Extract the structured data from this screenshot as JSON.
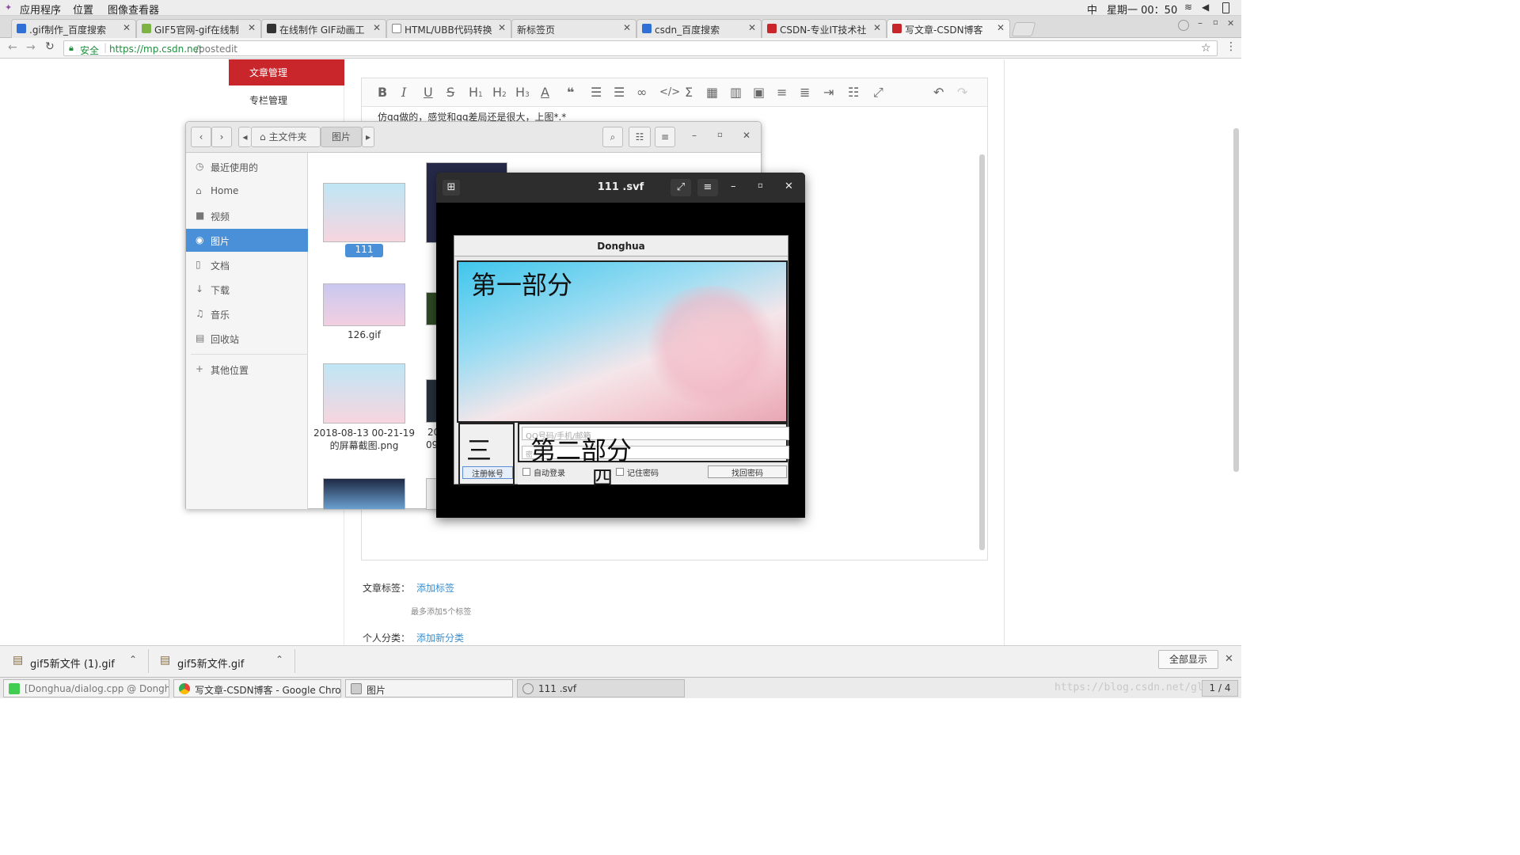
{
  "topbar": {
    "apps": "应用程序",
    "places": "位置",
    "viewer_app": "图像查看器",
    "ime": "中",
    "clock": "星期一 00：50"
  },
  "tabs": [
    {
      "label": ".gif制作_百度搜索",
      "color": "#2f6fd6"
    },
    {
      "label": "GIF5官网-gif在线制",
      "color": "#7cb342"
    },
    {
      "label": "在线制作 GIF动画工",
      "color": "#333333"
    },
    {
      "label": "HTML/UBB代码转换",
      "color": "#888888"
    },
    {
      "label": "新标签页",
      "color": "#cccccc"
    },
    {
      "label": "csdn_百度搜索",
      "color": "#2f6fd6"
    },
    {
      "label": "CSDN-专业IT技术社",
      "color": "#c9262c"
    },
    {
      "label": "写文章-CSDN博客",
      "color": "#c9262c"
    }
  ],
  "address": {
    "secure": "安全",
    "url_host": "https://mp.csdn.net",
    "url_path": "/postedit"
  },
  "leftnav": {
    "article_mgmt": "文章管理",
    "column_mgmt": "专栏管理"
  },
  "editor": {
    "content": "仿qq做的，感觉和qq差局还是很大，上图*.*"
  },
  "post_meta": {
    "tags_label": "文章标签：",
    "add_tag": "添加标签",
    "tag_hint": "最多添加5个标签",
    "category_label": "个人分类：",
    "add_category": "添加新分类"
  },
  "files": {
    "path_home": "主文件夹",
    "path_pictures": "图片",
    "sidebar": [
      {
        "label": "最近使用的",
        "icon": "clock-icon"
      },
      {
        "label": "Home",
        "icon": "home-icon"
      },
      {
        "label": "视频",
        "icon": "video-icon"
      },
      {
        "label": "图片",
        "icon": "camera-icon"
      },
      {
        "label": "文档",
        "icon": "document-icon"
      },
      {
        "label": "下载",
        "icon": "download-icon"
      },
      {
        "label": "音乐",
        "icon": "music-icon"
      },
      {
        "label": "回收站",
        "icon": "trash-icon"
      },
      {
        "label": "其他位置",
        "icon": "plus-icon"
      }
    ],
    "items": [
      {
        "label": "111 .svf"
      },
      {
        "label": "126.gif"
      },
      {
        "label": "2018-08-13  00-21-19\n的屏幕截图.png"
      }
    ],
    "partial_labels": [
      "20",
      "09"
    ]
  },
  "viewer": {
    "title": "111 .svf",
    "window_title": "Donghua",
    "part1": "第一部分",
    "part2": "第二部分",
    "part3": "三",
    "part4": "四",
    "account_placeholder": "QQ号码/手机/邮箱",
    "pwd_placeholder": "密",
    "register": "注册帐号",
    "auto_login": "自动登录",
    "remember": "记住密码",
    "find_pwd": "找回密码"
  },
  "downloads": {
    "items": [
      "gif5新文件 (1).gif",
      "gif5新文件.gif"
    ],
    "show_all": "全部显示"
  },
  "taskbar": {
    "items": [
      "[Donghua/dialog.cpp @ Donghua - ...",
      "写文章-CSDN博客 - Google Chrome",
      "图片",
      "111 .svf"
    ],
    "pager": "1 / 4",
    "watermark": "https://blog.csdn.net/gl"
  }
}
